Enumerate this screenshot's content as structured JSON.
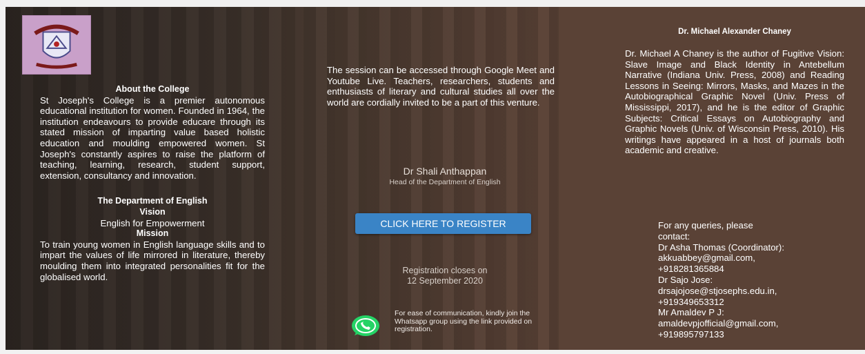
{
  "left": {
    "about_title": "About the College",
    "about_text": "St Joseph's College is a premier autonomous educational institution for women. Founded in 1964, the institution endeavours to provide educare through its stated mission of imparting value based holistic education and moulding empowered women. St Joseph's constantly aspires to raise the platform of teaching, learning, research, student support, extension, consultancy and innovation.",
    "dept_title": "The Department of English",
    "vision_title": "Vision",
    "vision_text": "English for Empowerment",
    "mission_title": "Mission",
    "mission_text": "To train young women in English language skills and to impart the values of life mirrored in literature, thereby moulding them into integrated personalities fit for the globalised world."
  },
  "middle": {
    "session_text": "The session can be accessed through Google Meet and Youtube Live. Teachers, researchers, students and enthusiasts of literary and cultural studies all over the world are cordially invited to be a part of this venture.",
    "speaker_name": "Dr Shali Anthappan",
    "speaker_role": "Head of the Department of English",
    "register_label": "CLICK HERE TO REGISTER",
    "closing_line1": "Registration closes on",
    "closing_line2": "12 September 2020",
    "whatsapp_text": "For ease of communication, kindly join the Whatsapp group using the link provided on registration."
  },
  "right": {
    "bio_title": "Dr. Michael Alexander Chaney",
    "bio_text": "Dr. Michael A Chaney is the author of Fugitive Vision: Slave Image and Black Identity in Antebellum Narrative (Indiana Univ. Press, 2008) and Reading Lessons in Seeing: Mirrors, Masks, and Mazes in the Autobiographical Graphic Novel (Univ. Press of Mississippi, 2017), and he is the editor of Graphic Subjects: Critical Essays on Autobiography and Graphic Novels (Univ. of Wisconsin Press, 2010). His writings have appeared in a host of journals both academic and creative.",
    "contact_lines": [
      "For any queries, please",
      "contact:",
      "Dr Asha Thomas (Coordinator):",
      "akkuabbey@gmail.com,",
      "+918281365884",
      "Dr Sajo Jose:",
      "drsajojose@stjosephs.edu.in,",
      "+919349653312",
      "Mr Amaldev P J:",
      "amaldevpjofficial@gmail.com,",
      "+919895797133"
    ]
  },
  "icons": {
    "logo": "college-crest-icon",
    "whatsapp": "whatsapp-icon"
  },
  "colors": {
    "register_button": "#3a84c6",
    "whatsapp_green": "#25d366"
  }
}
